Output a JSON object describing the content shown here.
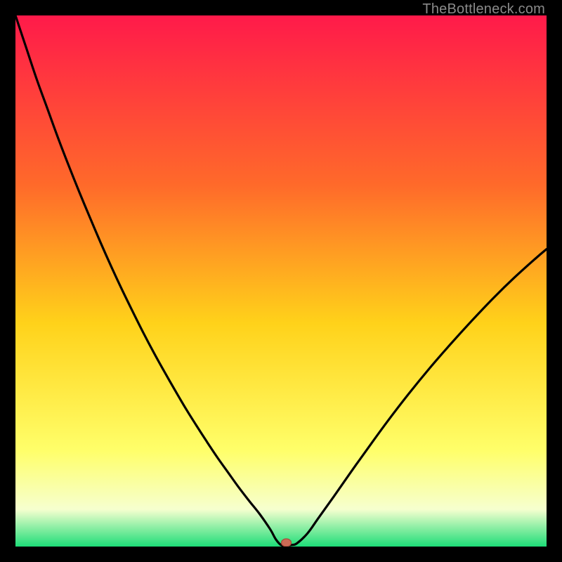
{
  "watermark": "TheBottleneck.com",
  "colors": {
    "frame": "#000000",
    "gradient_top": "#ff1a4a",
    "gradient_mid_upper": "#ff6a2a",
    "gradient_mid": "#ffd21a",
    "gradient_mid_lower": "#ffff6a",
    "gradient_lower": "#f6ffcf",
    "gradient_bottom": "#1edd78",
    "curve": "#000000",
    "marker_fill": "#cc6a55",
    "marker_stroke": "#aa4a3a"
  },
  "chart_data": {
    "type": "line",
    "title": "",
    "xlabel": "",
    "ylabel": "",
    "xlim": [
      0,
      100
    ],
    "ylim": [
      0,
      100
    ],
    "x": [
      0,
      2,
      4,
      6,
      8,
      10,
      12,
      14,
      16,
      18,
      20,
      22,
      24,
      26,
      28,
      30,
      32,
      34,
      36,
      38,
      40,
      42,
      44,
      46,
      48,
      49,
      50,
      51,
      52,
      53,
      55,
      57,
      60,
      63,
      66,
      70,
      74,
      78,
      82,
      86,
      90,
      94,
      98,
      100
    ],
    "values": [
      100,
      94,
      88,
      82.5,
      77,
      71.8,
      66.8,
      62,
      57.3,
      52.8,
      48.5,
      44.4,
      40.4,
      36.6,
      33,
      29.5,
      26.1,
      22.9,
      19.8,
      16.8,
      14,
      11.2,
      8.6,
      6.1,
      3.2,
      1.4,
      0.3,
      0.2,
      0.3,
      0.6,
      2.5,
      5.3,
      9.5,
      13.8,
      18,
      23.5,
      28.7,
      33.6,
      38.2,
      42.6,
      46.8,
      50.7,
      54.3,
      56.0
    ],
    "marker": {
      "x": 51,
      "y": 0.2
    },
    "curve_note": "V-shaped bottleneck curve; minimum at x≈51, y≈0."
  }
}
